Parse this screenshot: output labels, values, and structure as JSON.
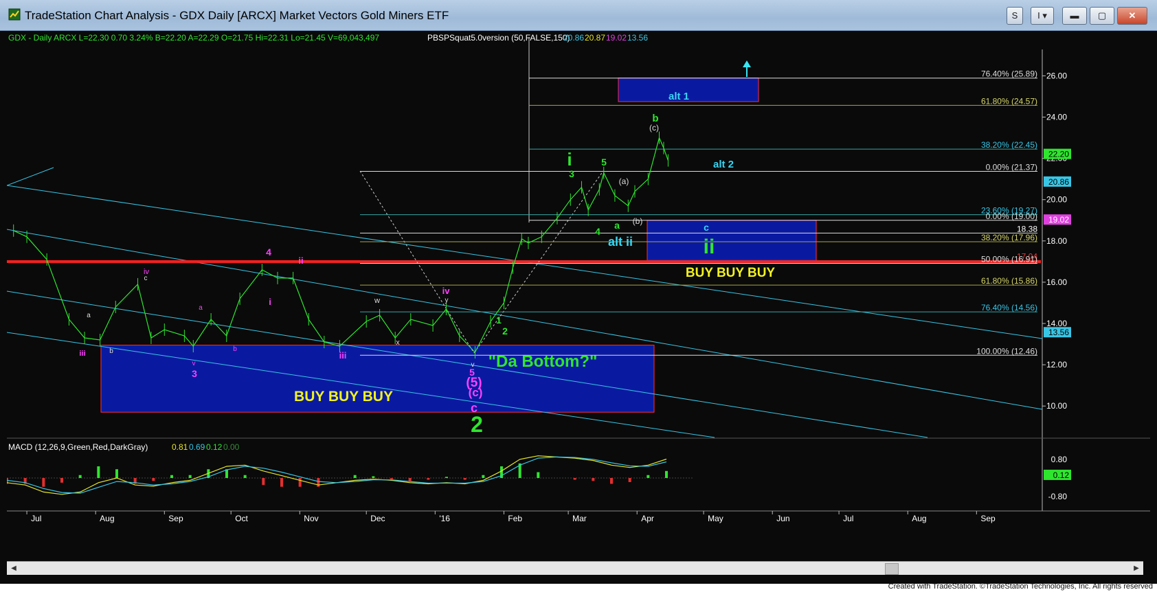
{
  "window": {
    "title": "TradeStation Chart Analysis - GDX Daily [ARCX] Market Vectors Gold Miners ETF",
    "btn_s": "S",
    "btn_i": "I"
  },
  "header": {
    "quote": "GDX - Daily  ARCX  L=22.30  0.70   3.24%   B=22.20  A=22.29  O=21.75  Hi=22.31  Lo=21.45  V=69,043,497",
    "indicator_name": "PBSPSquat5.0version (50,FALSE,150)",
    "indicator_values": [
      {
        "text": "20.86",
        "color": "#38c6e6"
      },
      {
        "text": "20.87",
        "color": "#e6e62a"
      },
      {
        "text": "19.02",
        "color": "#e040e0"
      },
      {
        "text": "13.56",
        "color": "#38c6e6"
      }
    ]
  },
  "macd_header": {
    "label": "MACD (12,26,9,Green,Red,DarkGray)",
    "values": [
      {
        "text": "0.81",
        "color": "#e6e62a"
      },
      {
        "text": "0.69",
        "color": "#38c6e6"
      },
      {
        "text": "0.12",
        "color": "#38e638"
      },
      {
        "text": "0.00",
        "color": "#3a8a3a"
      }
    ]
  },
  "credits": "Created with TradeStation. ©TradeStation Technologies, Inc. All rights reserved",
  "colors": {
    "background": "#0a0a0a",
    "price_bars": "#2ee62e",
    "channel": "#38c6e6",
    "support": "#ff2020",
    "box_fill": "#0a1aa0",
    "box_border": "#ff2a4a",
    "annot_yellow": "#f2f21e",
    "annot_green": "#2ee62e",
    "annot_magenta": "#ff40ff",
    "annot_cyan": "#38d6f2"
  },
  "chart_data": {
    "type": "line",
    "title": "GDX - Daily ARCX",
    "symbol": "GDX",
    "x_axis_ticks": [
      "Jul",
      "Aug",
      "Sep",
      "Oct",
      "Nov",
      "Dec",
      "'16",
      "Feb",
      "Mar",
      "Apr",
      "May",
      "Jun",
      "Jul",
      "Aug",
      "Sep"
    ],
    "y_axis_ticks": [
      10.0,
      12.0,
      14.0,
      16.0,
      18.0,
      20.0,
      22.0,
      24.0,
      26.0
    ],
    "ylim": [
      8.5,
      27.5
    ],
    "price_tags": [
      {
        "value": 22.2,
        "text": "22.20",
        "bg": "#2ee62e",
        "fg": "#000000"
      },
      {
        "value": 20.86,
        "text": "20.86",
        "bg": "#38c6e6",
        "fg": "#000000"
      },
      {
        "value": 19.02,
        "text": "19.02",
        "bg": "#e040e0",
        "fg": "#ffffff"
      },
      {
        "value": 13.56,
        "text": "13.56",
        "bg": "#38c6e6",
        "fg": "#000000"
      }
    ],
    "series": [
      {
        "name": "GDX",
        "x": [
          "2015-06-25",
          "2015-07-01",
          "2015-07-10",
          "2015-07-20",
          "2015-07-27",
          "2015-08-03",
          "2015-08-10",
          "2015-08-20",
          "2015-08-26",
          "2015-09-01",
          "2015-09-10",
          "2015-09-14",
          "2015-09-22",
          "2015-09-29",
          "2015-10-05",
          "2015-10-15",
          "2015-10-22",
          "2015-10-29",
          "2015-11-05",
          "2015-11-12",
          "2015-11-19",
          "2015-12-01",
          "2015-12-07",
          "2015-12-14",
          "2015-12-21",
          "2015-12-31",
          "2016-01-06",
          "2016-01-12",
          "2016-01-19",
          "2016-01-26",
          "2016-02-01",
          "2016-02-05",
          "2016-02-09",
          "2016-02-12",
          "2016-02-18",
          "2016-02-25",
          "2016-03-02",
          "2016-03-07",
          "2016-03-10",
          "2016-03-15",
          "2016-03-17",
          "2016-03-22",
          "2016-03-28",
          "2016-03-31",
          "2016-04-06",
          "2016-04-11",
          "2016-04-13",
          "2016-04-15"
        ],
        "values": [
          18.5,
          18.2,
          17.1,
          14.2,
          13.3,
          13.2,
          14.8,
          15.9,
          13.3,
          13.7,
          13.4,
          12.9,
          14.2,
          13.4,
          15.2,
          16.6,
          16.2,
          16.2,
          14.2,
          13.1,
          12.9,
          14.1,
          14.4,
          13.3,
          14.2,
          13.9,
          14.7,
          13.4,
          12.6,
          14.1,
          15.0,
          16.7,
          18.1,
          17.9,
          18.2,
          19.1,
          20.0,
          20.6,
          19.5,
          20.5,
          21.3,
          20.2,
          19.7,
          20.4,
          21.0,
          23.0,
          22.5,
          21.9
        ]
      }
    ],
    "fib_levels_right": [
      "76.40% (25.89)",
      "61.80% (24.57)",
      "38.20% (22.45)",
      "0.00% (21.37)",
      "23.60% (19.27)",
      "0.00% (19.00)",
      "18.38",
      "38.20% (17.96)",
      "17.04",
      "50.00% (16.91)",
      "61.80% (15.86)",
      "76.40% (14.56)",
      "100.00% (12.46)"
    ],
    "annotations": {
      "big_box_label": "BUY BUY BUY",
      "small_box_label": "BUY  BUY  BUY",
      "da_bottom": "\"Da Bottom?\"",
      "alt1": "alt 1",
      "alt2": "alt 2",
      "alt_ii": "alt ii",
      "wave_2": "2",
      "wave_c": "c",
      "wave_c_paren": "(c)",
      "wave_5_paren": "(5)",
      "wave_5": "5",
      "wave_i_big": "i",
      "wave_ii_big": "ii",
      "wave_b": "b",
      "wave_b_paren": "(b)",
      "wave_c_small": "(c)",
      "wave_a_paren": "(a)",
      "wave_a": "a",
      "wave_3": "3",
      "wave_4": "4",
      "wave_1": "1",
      "wave_2_small": "2",
      "wave_5_top": "5",
      "wave_iv": "iv",
      "wave_ii_mag": "ii",
      "wave_iii": "iii",
      "wave_iii_left": "iii",
      "wave_4_mag": "4",
      "wave_i_mag": "i",
      "wave_3_mag": "3",
      "wave_iv_left": "iv",
      "c_small": "c",
      "w_small": "w",
      "x_small": "x",
      "v_small": "v",
      "y_small": "y",
      "a_small": "a",
      "b_small": "b",
      "b_mag": "b",
      "a_mag": "a",
      "v_mag": "v",
      "c_cyan": "c"
    }
  },
  "macd_data": {
    "y_ticks": [
      "0.80",
      "-0.80"
    ],
    "tag": {
      "text": "0.12",
      "bg": "#2ee62e"
    },
    "macd": [
      -0.2,
      -0.3,
      -0.6,
      -0.7,
      -0.6,
      -0.2,
      0.0,
      -0.3,
      -0.35,
      -0.2,
      -0.1,
      0.2,
      0.5,
      0.55,
      0.3,
      0.1,
      -0.1,
      -0.3,
      -0.2,
      -0.1,
      -0.05,
      -0.1,
      -0.2,
      -0.25,
      -0.2,
      -0.25,
      -0.1,
      0.3,
      0.8,
      0.95,
      0.9,
      0.85,
      0.75,
      0.55,
      0.45,
      0.55,
      0.81
    ],
    "signal": [
      -0.1,
      -0.2,
      -0.45,
      -0.62,
      -0.65,
      -0.4,
      -0.15,
      -0.2,
      -0.3,
      -0.25,
      -0.15,
      0.05,
      0.35,
      0.5,
      0.42,
      0.25,
      0.05,
      -0.15,
      -0.2,
      -0.15,
      -0.08,
      -0.08,
      -0.15,
      -0.22,
      -0.22,
      -0.22,
      -0.15,
      0.1,
      0.55,
      0.85,
      0.9,
      0.88,
      0.8,
      0.65,
      0.52,
      0.5,
      0.69
    ]
  }
}
